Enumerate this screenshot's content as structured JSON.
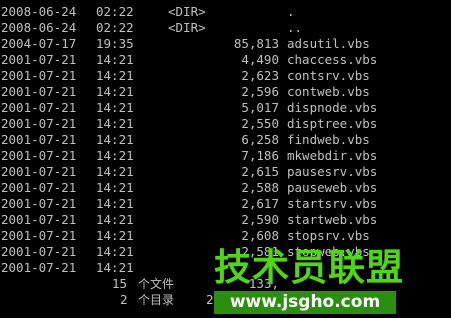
{
  "colors": {
    "background": "#000000",
    "text": "#c0c0c0",
    "watermark_green": "#4fd616",
    "watermark_bar": "#2a8f0f"
  },
  "listing": [
    {
      "date": "2008-06-24",
      "time": "02:22",
      "dir": "<DIR>",
      "size": "",
      "name": "."
    },
    {
      "date": "2008-06-24",
      "time": "02:22",
      "dir": "<DIR>",
      "size": "",
      "name": ".."
    },
    {
      "date": "2004-07-17",
      "time": "19:35",
      "dir": "",
      "size": "85,813",
      "name": "adsutil.vbs"
    },
    {
      "date": "2001-07-21",
      "time": "14:21",
      "dir": "",
      "size": "4,490",
      "name": "chaccess.vbs"
    },
    {
      "date": "2001-07-21",
      "time": "14:21",
      "dir": "",
      "size": "2,623",
      "name": "contsrv.vbs"
    },
    {
      "date": "2001-07-21",
      "time": "14:21",
      "dir": "",
      "size": "2,596",
      "name": "contweb.vbs"
    },
    {
      "date": "2001-07-21",
      "time": "14:21",
      "dir": "",
      "size": "5,017",
      "name": "dispnode.vbs"
    },
    {
      "date": "2001-07-21",
      "time": "14:21",
      "dir": "",
      "size": "2,550",
      "name": "disptree.vbs"
    },
    {
      "date": "2001-07-21",
      "time": "14:21",
      "dir": "",
      "size": "6,258",
      "name": "findweb.vbs"
    },
    {
      "date": "2001-07-21",
      "time": "14:21",
      "dir": "",
      "size": "7,186",
      "name": "mkwebdir.vbs"
    },
    {
      "date": "2001-07-21",
      "time": "14:21",
      "dir": "",
      "size": "2,615",
      "name": "pausesrv.vbs"
    },
    {
      "date": "2001-07-21",
      "time": "14:21",
      "dir": "",
      "size": "2,588",
      "name": "pauseweb.vbs"
    },
    {
      "date": "2001-07-21",
      "time": "14:21",
      "dir": "",
      "size": "2,617",
      "name": "startsrv.vbs"
    },
    {
      "date": "2001-07-21",
      "time": "14:21",
      "dir": "",
      "size": "2,590",
      "name": "startweb.vbs"
    },
    {
      "date": "2001-07-21",
      "time": "14:21",
      "dir": "",
      "size": "2,608",
      "name": "stopsrv.vbs"
    },
    {
      "date": "2001-07-21",
      "time": "14:21",
      "dir": "",
      "size": "2,581",
      "name": "stopweb.vbs"
    },
    {
      "date": "2001-07-21",
      "time": "14:21",
      "dir": "",
      "size": "",
      "name": ""
    }
  ],
  "summary": {
    "files_count": "15",
    "files_label": "个文件",
    "files_bytes": "133,",
    "dirs_count": "2",
    "dirs_label": "个目录",
    "dirs_bytes": "22,3"
  },
  "watermark": {
    "logo_text": "技术员联盟",
    "url": "www.jsgho.com"
  }
}
